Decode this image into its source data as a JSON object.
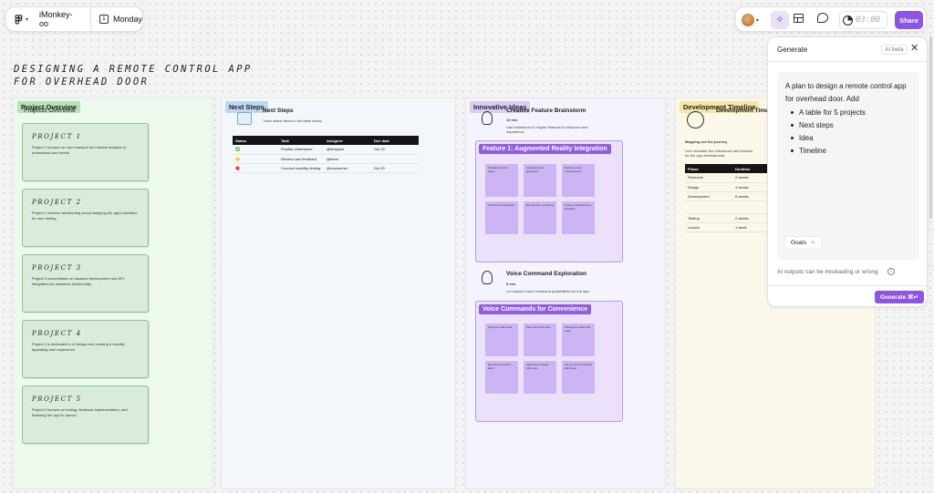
{
  "topbar": {
    "file_name": "iMonkey-oo",
    "page_name": "Monday",
    "timer": "03:00",
    "share_label": "Share"
  },
  "board": {
    "title_line1": "DESIGNING A REMOTE CONTROL APP",
    "title_line2": "FOR OVERHEAD DOOR"
  },
  "overview": {
    "tag": "Project Overview",
    "behind": "Projects Overview",
    "projects": [
      {
        "title": "PROJECT 1",
        "text": "Project 1 focuses on user research and market analysis to understand user needs."
      },
      {
        "title": "PROJECT 2",
        "text": "Project 2 involves wireframing and prototyping the app's interface for user testing."
      },
      {
        "title": "PROJECT 3",
        "text": "Project 3 concentrates on backend development and API integration for seamless functionality."
      },
      {
        "title": "PROJECT 4",
        "text": "Project 4 is dedicated to UI design and creating a visually appealing user experience."
      },
      {
        "title": "PROJECT 5",
        "text": "Project 5 focuses on testing, feedback implementation, and finalizing the app for launch."
      }
    ]
  },
  "next_steps": {
    "tag": "Next Steps",
    "title": "Next Steps",
    "subtitle": "Track action items in the table below.",
    "headers": [
      "Status",
      "Task",
      "Assignee",
      "Due date"
    ],
    "rows": [
      {
        "status": "✅",
        "task": "Finalize wireframes",
        "assignee": "@designer",
        "due": "Oct 15"
      },
      {
        "status": "🟡",
        "task": "Review user feedback",
        "assignee": "@team",
        "due": ""
      },
      {
        "status": "🔴",
        "task": "Conduct usability testing",
        "assignee": "@researcher",
        "due": "Oct 20"
      }
    ]
  },
  "ideas": {
    "tag": "Innovative Ideas",
    "brainstorm_title": "Creative Feature Brainstorm",
    "brainstorm_meta": "10 min",
    "brainstorm_desc": "Use brainstorm to inspire features to enhance user experience.",
    "feature_frame_title": "Feature 1: Augmented Reality Integration",
    "feature_stickies": [
      "Visualize the door status",
      "Interactive door placement",
      "Real-time door measurements",
      "Smart home integration",
      "Remote door monitoring",
      "Gesture controlled door operation"
    ],
    "voice_title": "Voice Command Exploration",
    "voice_meta": "5 min",
    "voice_desc": "Let explore voice command possibilities for the app.",
    "voice_frame_title": "Voice Commands for Convenience",
    "voice_stickies": [
      "Open door with voice",
      "Close door with voice",
      "Check door status with voice",
      "Set voice command alerts",
      "Adjust door settings with voice",
      "Set up voice commands with Alexa"
    ]
  },
  "timeline": {
    "tag": "Development Timeline",
    "behind": "Development Timeline",
    "subtitle": "Mapping out the journey",
    "desc": "Let's visualize the milestones and timeline for the app development.",
    "headers": [
      "Phase",
      "Duration",
      ""
    ],
    "rows": [
      {
        "phase": "Research",
        "duration": "2 weeks"
      },
      {
        "phase": "Design",
        "duration": "4 weeks"
      },
      {
        "phase": "Development",
        "duration": "6 weeks"
      },
      {
        "phase": "",
        "duration": ""
      },
      {
        "phase": "Testing",
        "duration": "2 weeks"
      },
      {
        "phase": "Launch",
        "duration": "1 week"
      }
    ]
  },
  "generate": {
    "header": "Generate",
    "badge": "AI beta",
    "prompt_line1": "A plan to design a remote control app",
    "prompt_line2": "for overhead door. Add",
    "bullets": [
      "A table for 5 projects",
      "Next steps",
      "Idea",
      "Timeline"
    ],
    "chip": "Goals",
    "disclaimer": "AI outputs can be misleading or wrong",
    "button": "Generate ⌘↵"
  },
  "colors": {
    "accent": "#8b55e6",
    "overview_bg": "#eef9ee",
    "next_bg": "#f3f6fb",
    "ideas_bg": "#f5f3fb",
    "timeline_bg": "#fbf8e9"
  }
}
